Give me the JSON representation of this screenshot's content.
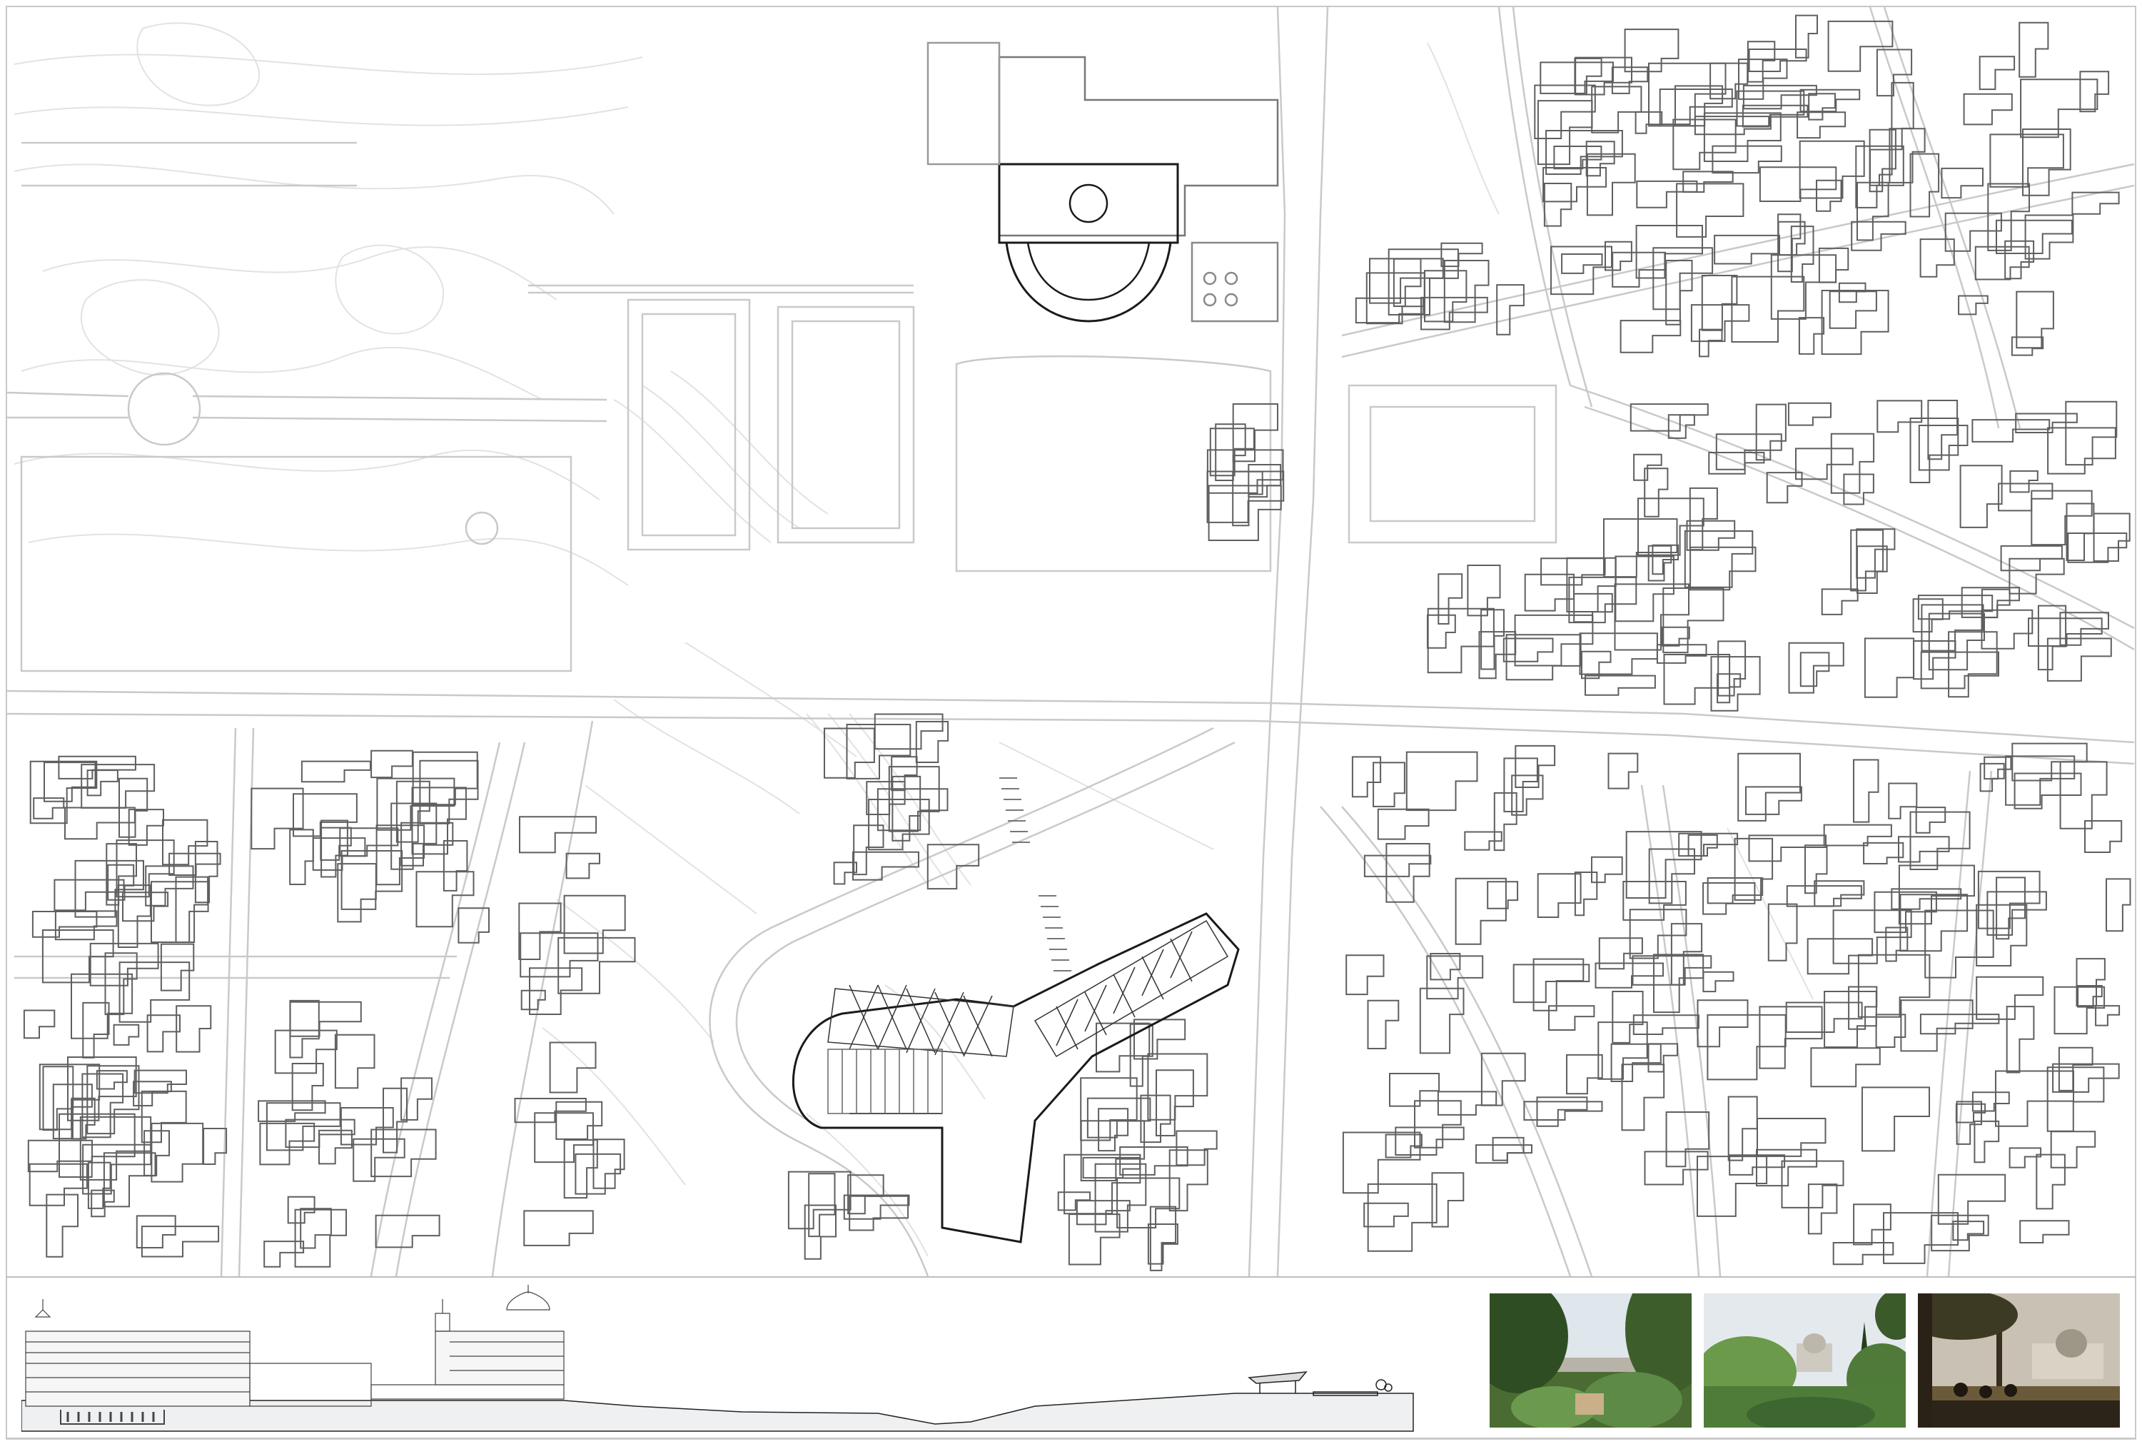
{
  "sheet": {
    "background": "#ffffff",
    "line_color_light": "#cfcfcf",
    "line_color_building": "#5a5a5a",
    "line_color_highlight": "#1a1a1a"
  },
  "map": {
    "type": "urban site plan",
    "layers": [
      "contour-lines",
      "building-footprints",
      "streets",
      "park-paths",
      "project-canopy"
    ]
  },
  "section": {
    "type": "site section elevation",
    "ground_fill": "#eef0f1"
  },
  "photos": [
    {
      "subject": "park-view-with-city-skyline",
      "sky": "#dfe6ec",
      "foliage": "#4f7a3a"
    },
    {
      "subject": "garden-view-with-cathedral-dome",
      "sky": "#e4e9ee",
      "foliage": "#5d8a46"
    },
    {
      "subject": "terrace-view-with-cathedral-at-sunset",
      "sky": "#c9c2b4",
      "foliage": "#6b5a3a"
    }
  ]
}
